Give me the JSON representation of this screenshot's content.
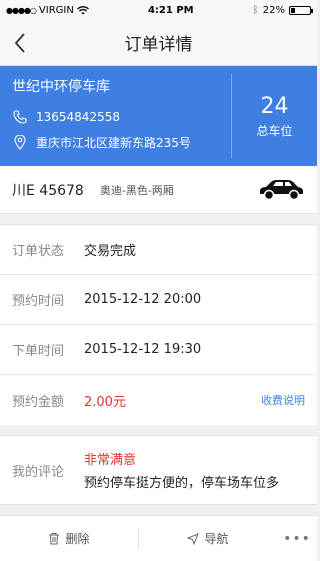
{
  "status_bar": {
    "carrier": "VIRGIN",
    "time": "4:21 PM",
    "battery": "22%",
    "battery_level": 0.22
  },
  "nav": {
    "title": "订单详情",
    "back_icon": "chevron-left-icon"
  },
  "lot": {
    "name": "世纪中环停车库",
    "phone": "13654842558",
    "address": "重庆市江北区建新东路235号",
    "spaces_count": "24",
    "spaces_label": "总车位",
    "bg_color": "#3f7fe2"
  },
  "car": {
    "plate": "川E 45678",
    "description": "奥迪-黑色-两厢"
  },
  "details": [
    {
      "label": "订单状态",
      "value": "交易完成"
    },
    {
      "label": "预约时间",
      "value": "2015-12-12 20:00"
    },
    {
      "label": "下单时间",
      "value": "2015-12-12 19:30"
    },
    {
      "label": "预约金额",
      "value": "2.00元",
      "link": "收费说明"
    }
  ],
  "review": {
    "label": "我的评论",
    "rating": "非常满意",
    "comment": "预约停车挺方便的，停车场车位多"
  },
  "toolbar": {
    "delete_label": "删除",
    "navigate_label": "导航",
    "more_label": "•••"
  },
  "colors": {
    "accent": "#3f7fe2",
    "price_red": "#e0362c"
  }
}
